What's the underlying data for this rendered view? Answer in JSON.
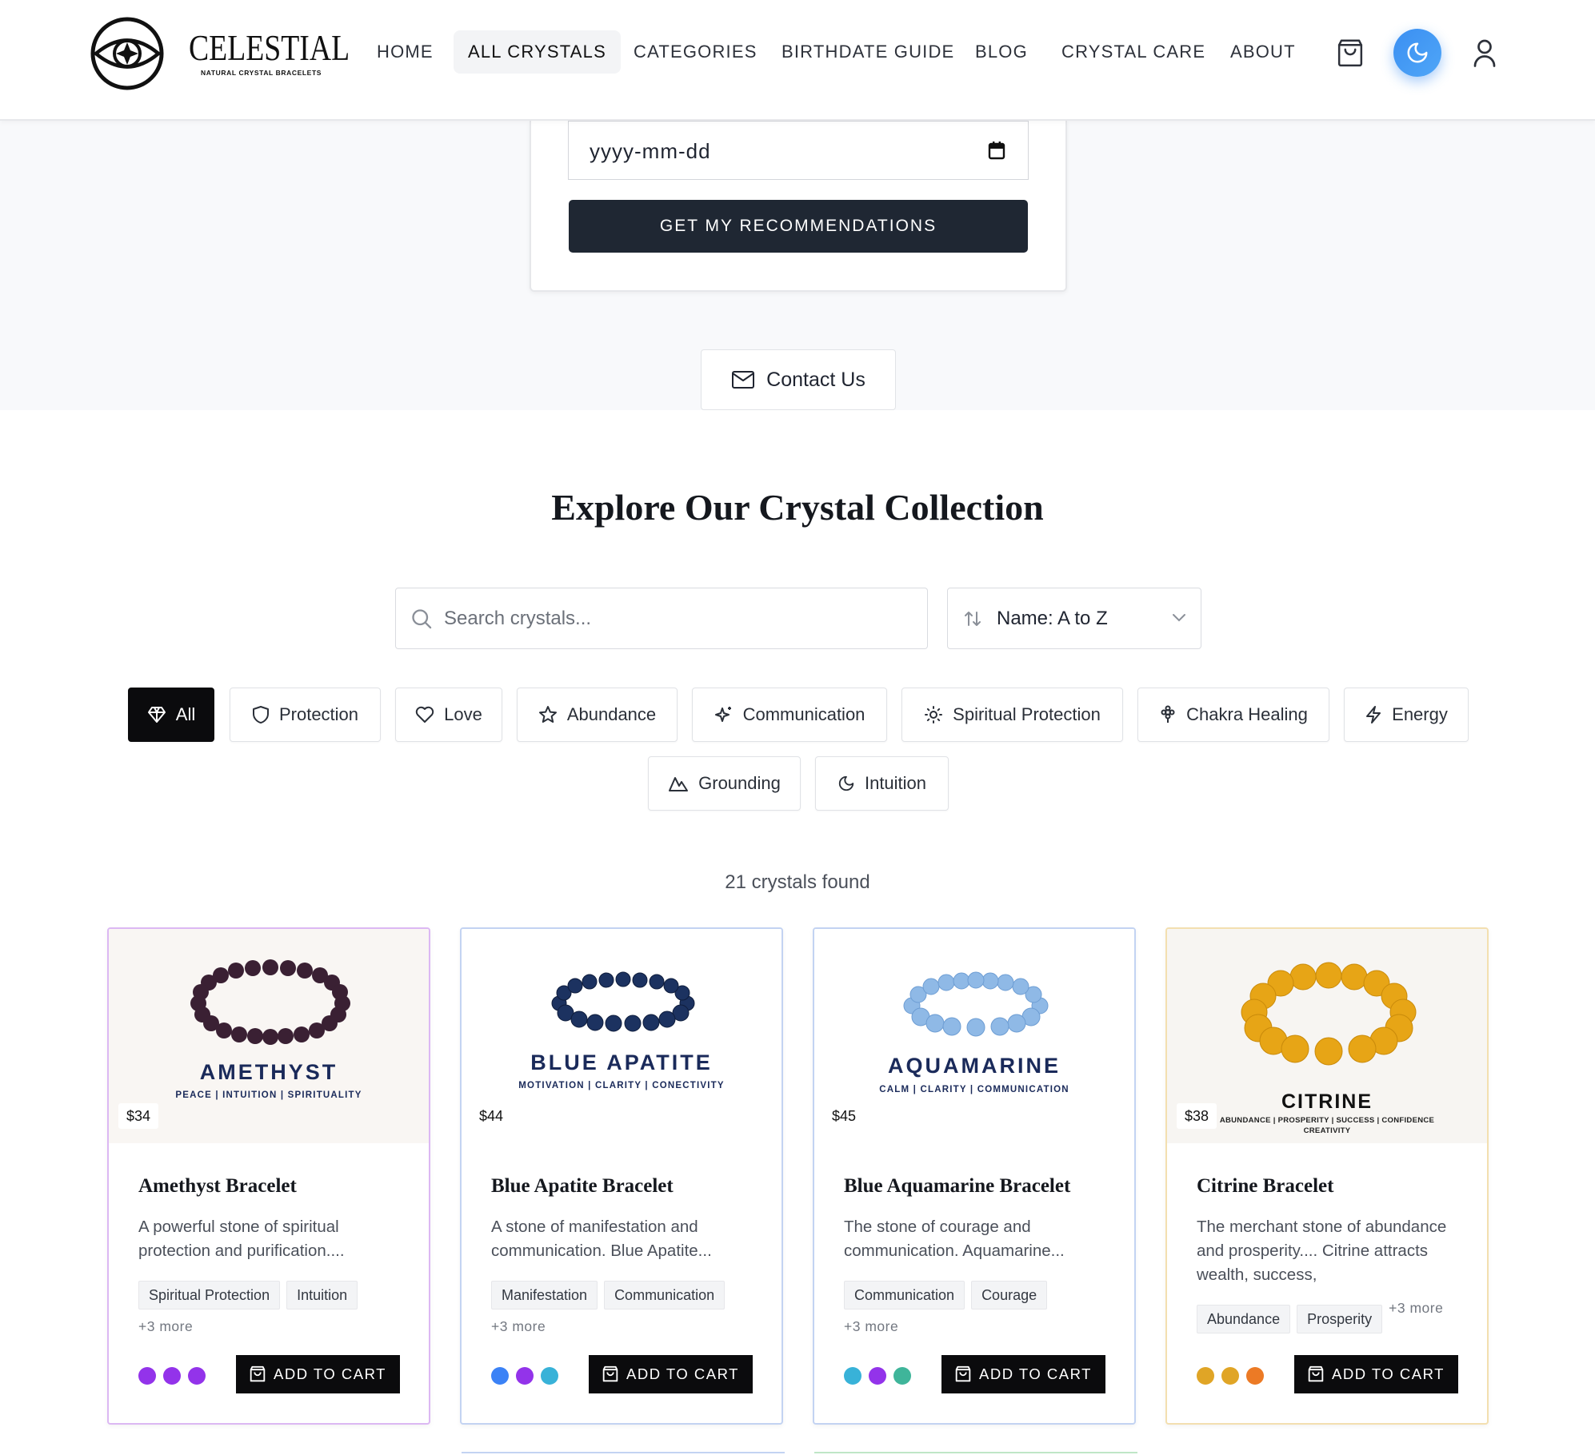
{
  "header": {
    "brand_name": "CELESTIAL",
    "brand_tagline": "NATURAL CRYSTAL BRACELETS",
    "nav": [
      {
        "label": "HOME",
        "active": false
      },
      {
        "label": "ALL CRYSTALS",
        "active": true
      },
      {
        "label": "CATEGORIES",
        "active": false
      },
      {
        "label": "BIRTHDATE GUIDE",
        "active": false
      },
      {
        "label": "BLOG",
        "active": false
      },
      {
        "label": "CRYSTAL CARE",
        "active": false
      },
      {
        "label": "ABOUT",
        "active": false
      }
    ],
    "icons": [
      "shopping-bag-icon",
      "moon-icon",
      "user-icon"
    ]
  },
  "birthdate_form": {
    "date_placeholder": "yyyy-mm-dd",
    "submit_label": "GET MY RECOMMENDATIONS"
  },
  "contact": {
    "label": "Contact Us"
  },
  "collection": {
    "title": "Explore Our Crystal Collection",
    "search_placeholder": "Search crystals...",
    "sort_value": "Name: A to Z",
    "filters": [
      {
        "label": "All",
        "icon": "gem-icon",
        "active": true
      },
      {
        "label": "Protection",
        "icon": "shield-icon",
        "active": false
      },
      {
        "label": "Love",
        "icon": "heart-icon",
        "active": false
      },
      {
        "label": "Abundance",
        "icon": "star-icon",
        "active": false
      },
      {
        "label": "Communication",
        "icon": "sparkles-icon",
        "active": false
      },
      {
        "label": "Spiritual Protection",
        "icon": "sun-icon",
        "active": false
      },
      {
        "label": "Chakra Healing",
        "icon": "flower-icon",
        "active": false
      },
      {
        "label": "Energy",
        "icon": "bolt-icon",
        "active": false
      },
      {
        "label": "Grounding",
        "icon": "mountain-icon",
        "active": false
      },
      {
        "label": "Intuition",
        "icon": "moon-icon",
        "active": false
      }
    ],
    "results_count": "21 crystals found"
  },
  "products": [
    {
      "image_title": "AMETHYST",
      "image_subtitle": "PEACE | INTUITION | SPIRITUALITY",
      "price": "$34",
      "name": "Amethyst Bracelet",
      "description": "A powerful stone of spiritual protection and purification....",
      "tags": [
        "Spiritual Protection",
        "Intuition"
      ],
      "more": "+3 more",
      "dot_colors": [
        "#9333ea",
        "#9333ea",
        "#9333ea"
      ],
      "border_color": "#dcb8f3",
      "bead_color": "#3a2033",
      "add_label": "ADD TO CART"
    },
    {
      "image_title": "BLUE APATITE",
      "image_subtitle": "MOTIVATION | CLARITY | CONECTIVITY",
      "price": "$44",
      "name": "Blue Apatite Bracelet",
      "description": "A stone of manifestation and communication. Blue Apatite...",
      "tags": [
        "Manifestation",
        "Communication"
      ],
      "more": "+3 more",
      "dot_colors": [
        "#3b82f6",
        "#9333ea",
        "#38b2d8"
      ],
      "border_color": "#c3d3f2",
      "bead_color": "#1c3260",
      "add_label": "ADD TO CART"
    },
    {
      "image_title": "AQUAMARINE",
      "image_subtitle": "CALM | CLARITY | COMMUNICATION",
      "price": "$45",
      "name": "Blue Aquamarine Bracelet",
      "description": "The stone of courage and communication. Aquamarine...",
      "tags": [
        "Communication",
        "Courage"
      ],
      "more": "+3 more",
      "dot_colors": [
        "#38b2d8",
        "#9333ea",
        "#3fb59a"
      ],
      "border_color": "#c3d3f2",
      "bead_color": "#8fb9e6",
      "add_label": "ADD TO CART"
    },
    {
      "image_title": "CITRINE",
      "image_subtitle": "ABUNDANCE | PROSPERITY | SUCCESS | CONFIDENCE",
      "image_subtitle2": "CREATIVITY",
      "price": "$38",
      "name": "Citrine Bracelet",
      "description": "The merchant stone of abundance and prosperity.... Citrine attracts wealth, success,",
      "tags": [
        "Abundance",
        "Prosperity"
      ],
      "more": "+3 more",
      "dot_colors": [
        "#e0a526",
        "#e0a526",
        "#ec7a25"
      ],
      "border_color": "#f3dfb0",
      "bead_color": "#e7a516",
      "add_label": "ADD TO CART"
    }
  ]
}
